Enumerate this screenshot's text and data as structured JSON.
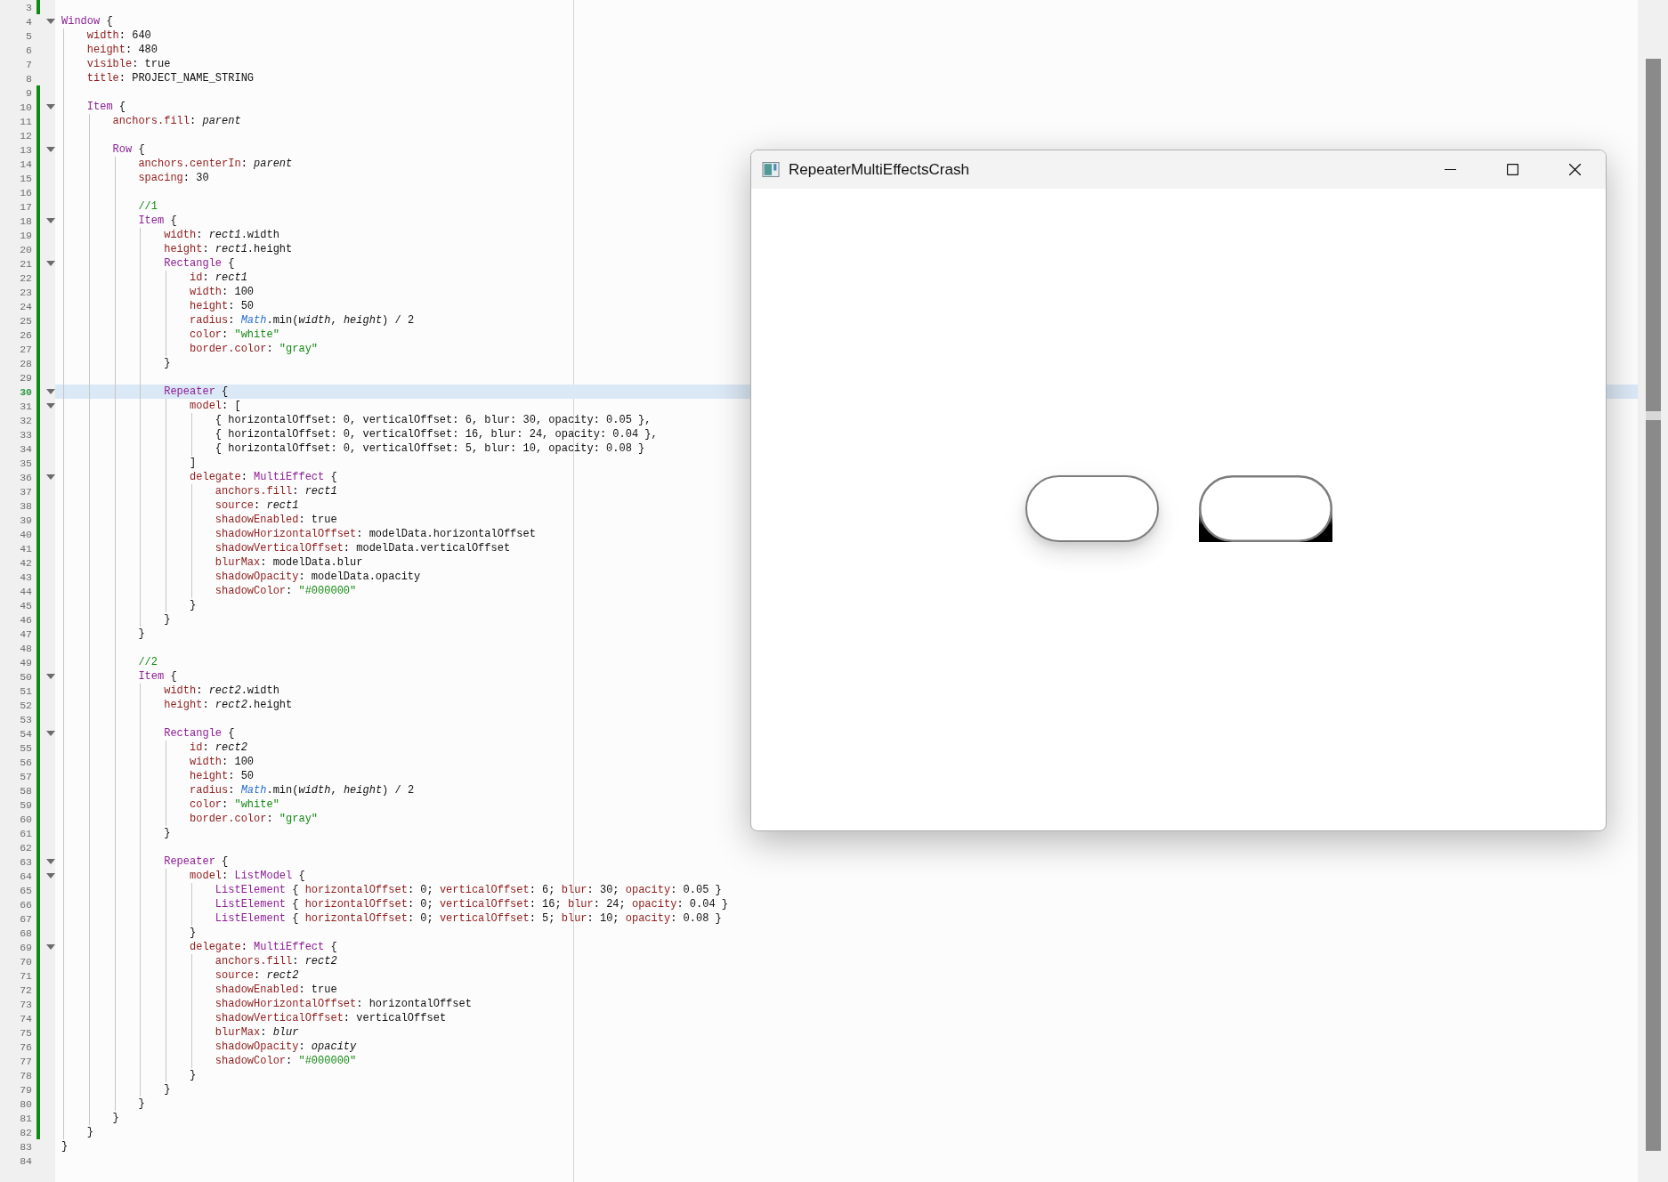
{
  "editor": {
    "lines": [
      {
        "number": "3",
        "fold": false,
        "modified": true,
        "current": false
      },
      {
        "number": "4",
        "fold": true,
        "modified": false,
        "current": false,
        "segs": [
          {
            "kind": "type",
            "text": "Window"
          },
          {
            "kind": "plain",
            "text": " {"
          }
        ]
      },
      {
        "number": "5",
        "fold": false,
        "modified": false,
        "current": false,
        "segs": [
          {
            "kind": "prop",
            "text": "    width"
          },
          {
            "kind": "plain",
            "text": ": 640"
          }
        ]
      },
      {
        "number": "6",
        "fold": false,
        "modified": false,
        "current": false,
        "segs": [
          {
            "kind": "prop",
            "text": "    height"
          },
          {
            "kind": "plain",
            "text": ": 480"
          }
        ]
      },
      {
        "number": "7",
        "fold": false,
        "modified": false,
        "current": false,
        "segs": [
          {
            "kind": "prop",
            "text": "    visible"
          },
          {
            "kind": "plain",
            "text": ": true"
          }
        ]
      },
      {
        "number": "8",
        "fold": false,
        "modified": false,
        "current": false,
        "segs": [
          {
            "kind": "prop",
            "text": "    title"
          },
          {
            "kind": "plain",
            "text": ": PROJECT_NAME_STRING"
          }
        ]
      },
      {
        "number": "9",
        "fold": false,
        "modified": true,
        "current": false
      },
      {
        "number": "10",
        "fold": true,
        "modified": true,
        "current": false,
        "segs": [
          {
            "kind": "type",
            "text": "    Item"
          },
          {
            "kind": "plain",
            "text": " {"
          }
        ]
      },
      {
        "number": "11",
        "fold": false,
        "modified": true,
        "current": false,
        "segs": [
          {
            "kind": "prop",
            "text": "        anchors.fill"
          },
          {
            "kind": "plain",
            "text": ": "
          },
          {
            "kind": "italic",
            "text": "parent"
          }
        ]
      },
      {
        "number": "12",
        "fold": false,
        "modified": true,
        "current": false
      },
      {
        "number": "13",
        "fold": true,
        "modified": true,
        "current": false,
        "segs": [
          {
            "kind": "type",
            "text": "        Row"
          },
          {
            "kind": "plain",
            "text": " {"
          }
        ]
      },
      {
        "number": "14",
        "fold": false,
        "modified": true,
        "current": false,
        "segs": [
          {
            "kind": "prop",
            "text": "            anchors.centerIn"
          },
          {
            "kind": "plain",
            "text": ": "
          },
          {
            "kind": "italic",
            "text": "parent"
          }
        ]
      },
      {
        "number": "15",
        "fold": false,
        "modified": true,
        "current": false,
        "segs": [
          {
            "kind": "prop",
            "text": "            spacing"
          },
          {
            "kind": "plain",
            "text": ": 30"
          }
        ]
      },
      {
        "number": "16",
        "fold": false,
        "modified": true,
        "current": false
      },
      {
        "number": "17",
        "fold": false,
        "modified": true,
        "current": false,
        "segs": [
          {
            "kind": "comment",
            "text": "            //1"
          }
        ]
      },
      {
        "number": "18",
        "fold": true,
        "modified": true,
        "current": false,
        "segs": [
          {
            "kind": "type",
            "text": "            Item"
          },
          {
            "kind": "plain",
            "text": " {"
          }
        ]
      },
      {
        "number": "19",
        "fold": false,
        "modified": true,
        "current": false,
        "segs": [
          {
            "kind": "prop",
            "text": "                width"
          },
          {
            "kind": "plain",
            "text": ": "
          },
          {
            "kind": "italic",
            "text": "rect1"
          },
          {
            "kind": "plain",
            "text": ".width"
          }
        ]
      },
      {
        "number": "20",
        "fold": false,
        "modified": true,
        "current": false,
        "segs": [
          {
            "kind": "prop",
            "text": "                height"
          },
          {
            "kind": "plain",
            "text": ": "
          },
          {
            "kind": "italic",
            "text": "rect1"
          },
          {
            "kind": "plain",
            "text": ".height"
          }
        ]
      },
      {
        "number": "21",
        "fold": true,
        "modified": true,
        "current": false,
        "segs": [
          {
            "kind": "type",
            "text": "                Rectangle"
          },
          {
            "kind": "plain",
            "text": " {"
          }
        ]
      },
      {
        "number": "22",
        "fold": false,
        "modified": true,
        "current": false,
        "segs": [
          {
            "kind": "prop",
            "text": "                    id"
          },
          {
            "kind": "plain",
            "text": ": "
          },
          {
            "kind": "italic",
            "text": "rect1"
          }
        ]
      },
      {
        "number": "23",
        "fold": false,
        "modified": true,
        "current": false,
        "segs": [
          {
            "kind": "prop",
            "text": "                    width"
          },
          {
            "kind": "plain",
            "text": ": 100"
          }
        ]
      },
      {
        "number": "24",
        "fold": false,
        "modified": true,
        "current": false,
        "segs": [
          {
            "kind": "prop",
            "text": "                    height"
          },
          {
            "kind": "plain",
            "text": ": 50"
          }
        ]
      },
      {
        "number": "25",
        "fold": false,
        "modified": true,
        "current": false,
        "segs": [
          {
            "kind": "prop",
            "text": "                    radius"
          },
          {
            "kind": "plain",
            "text": ": "
          },
          {
            "kind": "builtin",
            "text": "Math"
          },
          {
            "kind": "plain",
            "text": ".min("
          },
          {
            "kind": "italic",
            "text": "width"
          },
          {
            "kind": "plain",
            "text": ", "
          },
          {
            "kind": "italic",
            "text": "height"
          },
          {
            "kind": "plain",
            "text": ") / 2"
          }
        ]
      },
      {
        "number": "26",
        "fold": false,
        "modified": true,
        "current": false,
        "segs": [
          {
            "kind": "prop",
            "text": "                    color"
          },
          {
            "kind": "plain",
            "text": ": "
          },
          {
            "kind": "string",
            "text": "\"white\""
          }
        ]
      },
      {
        "number": "27",
        "fold": false,
        "modified": true,
        "current": false,
        "segs": [
          {
            "kind": "prop",
            "text": "                    border.color"
          },
          {
            "kind": "plain",
            "text": ": "
          },
          {
            "kind": "string",
            "text": "\"gray\""
          }
        ]
      },
      {
        "number": "28",
        "fold": false,
        "modified": true,
        "current": false,
        "segs": [
          {
            "kind": "plain",
            "text": "                }"
          }
        ]
      },
      {
        "number": "29",
        "fold": false,
        "modified": true,
        "current": false
      },
      {
        "number": "30",
        "fold": true,
        "modified": true,
        "current": true,
        "segs": [
          {
            "kind": "type",
            "text": "                Repeater"
          },
          {
            "kind": "plain",
            "text": " {"
          }
        ]
      },
      {
        "number": "31",
        "fold": true,
        "modified": true,
        "current": false,
        "segs": [
          {
            "kind": "prop",
            "text": "                    model"
          },
          {
            "kind": "plain",
            "text": ": ["
          }
        ]
      },
      {
        "number": "32",
        "fold": false,
        "modified": true,
        "current": false,
        "segs": [
          {
            "kind": "plain",
            "text": "                        { horizontalOffset: 0, verticalOffset: 6, blur: 30, opacity: 0.05 },"
          }
        ]
      },
      {
        "number": "33",
        "fold": false,
        "modified": true,
        "current": false,
        "segs": [
          {
            "kind": "plain",
            "text": "                        { horizontalOffset: 0, verticalOffset: 16, blur: 24, opacity: 0.04 },"
          }
        ]
      },
      {
        "number": "34",
        "fold": false,
        "modified": true,
        "current": false,
        "segs": [
          {
            "kind": "plain",
            "text": "                        { horizontalOffset: 0, verticalOffset: 5, blur: 10, opacity: 0.08 }"
          }
        ]
      },
      {
        "number": "35",
        "fold": false,
        "modified": true,
        "current": false,
        "segs": [
          {
            "kind": "plain",
            "text": "                    ]"
          }
        ]
      },
      {
        "number": "36",
        "fold": true,
        "modified": true,
        "current": false,
        "segs": [
          {
            "kind": "prop",
            "text": "                    delegate"
          },
          {
            "kind": "plain",
            "text": ": "
          },
          {
            "kind": "type",
            "text": "MultiEffect"
          },
          {
            "kind": "plain",
            "text": " {"
          }
        ]
      },
      {
        "number": "37",
        "fold": false,
        "modified": true,
        "current": false,
        "segs": [
          {
            "kind": "prop",
            "text": "                        anchors.fill"
          },
          {
            "kind": "plain",
            "text": ": "
          },
          {
            "kind": "italic",
            "text": "rect1"
          }
        ]
      },
      {
        "number": "38",
        "fold": false,
        "modified": true,
        "current": false,
        "segs": [
          {
            "kind": "prop",
            "text": "                        source"
          },
          {
            "kind": "plain",
            "text": ": "
          },
          {
            "kind": "italic",
            "text": "rect1"
          }
        ]
      },
      {
        "number": "39",
        "fold": false,
        "modified": true,
        "current": false,
        "segs": [
          {
            "kind": "prop",
            "text": "                        shadowEnabled"
          },
          {
            "kind": "plain",
            "text": ": true"
          }
        ]
      },
      {
        "number": "40",
        "fold": false,
        "modified": true,
        "current": false,
        "segs": [
          {
            "kind": "prop",
            "text": "                        shadowHorizontalOffset"
          },
          {
            "kind": "plain",
            "text": ": modelData.horizontalOffset"
          }
        ]
      },
      {
        "number": "41",
        "fold": false,
        "modified": true,
        "current": false,
        "segs": [
          {
            "kind": "prop",
            "text": "                        shadowVerticalOffset"
          },
          {
            "kind": "plain",
            "text": ": modelData.verticalOffset"
          }
        ]
      },
      {
        "number": "42",
        "fold": false,
        "modified": true,
        "current": false,
        "segs": [
          {
            "kind": "prop",
            "text": "                        blurMax"
          },
          {
            "kind": "plain",
            "text": ": modelData.blur"
          }
        ]
      },
      {
        "number": "43",
        "fold": false,
        "modified": true,
        "current": false,
        "segs": [
          {
            "kind": "prop",
            "text": "                        shadowOpacity"
          },
          {
            "kind": "plain",
            "text": ": modelData.opacity"
          }
        ]
      },
      {
        "number": "44",
        "fold": false,
        "modified": true,
        "current": false,
        "segs": [
          {
            "kind": "prop",
            "text": "                        shadowColor"
          },
          {
            "kind": "plain",
            "text": ": "
          },
          {
            "kind": "string",
            "text": "\"#000000\""
          }
        ]
      },
      {
        "number": "45",
        "fold": false,
        "modified": true,
        "current": false,
        "segs": [
          {
            "kind": "plain",
            "text": "                    }"
          }
        ]
      },
      {
        "number": "46",
        "fold": false,
        "modified": true,
        "current": false,
        "segs": [
          {
            "kind": "plain",
            "text": "                }"
          }
        ]
      },
      {
        "number": "47",
        "fold": false,
        "modified": true,
        "current": false,
        "segs": [
          {
            "kind": "plain",
            "text": "            }"
          }
        ]
      },
      {
        "number": "48",
        "fold": false,
        "modified": true,
        "current": false
      },
      {
        "number": "49",
        "fold": false,
        "modified": true,
        "current": false,
        "segs": [
          {
            "kind": "comment",
            "text": "            //2"
          }
        ]
      },
      {
        "number": "50",
        "fold": true,
        "modified": true,
        "current": false,
        "segs": [
          {
            "kind": "type",
            "text": "            Item"
          },
          {
            "kind": "plain",
            "text": " {"
          }
        ]
      },
      {
        "number": "51",
        "fold": false,
        "modified": true,
        "current": false,
        "segs": [
          {
            "kind": "prop",
            "text": "                width"
          },
          {
            "kind": "plain",
            "text": ": "
          },
          {
            "kind": "italic",
            "text": "rect2"
          },
          {
            "kind": "plain",
            "text": ".width"
          }
        ]
      },
      {
        "number": "52",
        "fold": false,
        "modified": true,
        "current": false,
        "segs": [
          {
            "kind": "prop",
            "text": "                height"
          },
          {
            "kind": "plain",
            "text": ": "
          },
          {
            "kind": "italic",
            "text": "rect2"
          },
          {
            "kind": "plain",
            "text": ".height"
          }
        ]
      },
      {
        "number": "53",
        "fold": false,
        "modified": true,
        "current": false
      },
      {
        "number": "54",
        "fold": true,
        "modified": true,
        "current": false,
        "segs": [
          {
            "kind": "type",
            "text": "                Rectangle"
          },
          {
            "kind": "plain",
            "text": " {"
          }
        ]
      },
      {
        "number": "55",
        "fold": false,
        "modified": true,
        "current": false,
        "segs": [
          {
            "kind": "prop",
            "text": "                    id"
          },
          {
            "kind": "plain",
            "text": ": "
          },
          {
            "kind": "italic",
            "text": "rect2"
          }
        ]
      },
      {
        "number": "56",
        "fold": false,
        "modified": true,
        "current": false,
        "segs": [
          {
            "kind": "prop",
            "text": "                    width"
          },
          {
            "kind": "plain",
            "text": ": 100"
          }
        ]
      },
      {
        "number": "57",
        "fold": false,
        "modified": true,
        "current": false,
        "segs": [
          {
            "kind": "prop",
            "text": "                    height"
          },
          {
            "kind": "plain",
            "text": ": 50"
          }
        ]
      },
      {
        "number": "58",
        "fold": false,
        "modified": true,
        "current": false,
        "segs": [
          {
            "kind": "prop",
            "text": "                    radius"
          },
          {
            "kind": "plain",
            "text": ": "
          },
          {
            "kind": "builtin",
            "text": "Math"
          },
          {
            "kind": "plain",
            "text": ".min("
          },
          {
            "kind": "italic",
            "text": "width"
          },
          {
            "kind": "plain",
            "text": ", "
          },
          {
            "kind": "italic",
            "text": "height"
          },
          {
            "kind": "plain",
            "text": ") / 2"
          }
        ]
      },
      {
        "number": "59",
        "fold": false,
        "modified": true,
        "current": false,
        "segs": [
          {
            "kind": "prop",
            "text": "                    color"
          },
          {
            "kind": "plain",
            "text": ": "
          },
          {
            "kind": "string",
            "text": "\"white\""
          }
        ]
      },
      {
        "number": "60",
        "fold": false,
        "modified": true,
        "current": false,
        "segs": [
          {
            "kind": "prop",
            "text": "                    border.color"
          },
          {
            "kind": "plain",
            "text": ": "
          },
          {
            "kind": "string",
            "text": "\"gray\""
          }
        ]
      },
      {
        "number": "61",
        "fold": false,
        "modified": true,
        "current": false,
        "segs": [
          {
            "kind": "plain",
            "text": "                }"
          }
        ]
      },
      {
        "number": "62",
        "fold": false,
        "modified": true,
        "current": false
      },
      {
        "number": "63",
        "fold": true,
        "modified": true,
        "current": false,
        "segs": [
          {
            "kind": "type",
            "text": "                Repeater"
          },
          {
            "kind": "plain",
            "text": " {"
          }
        ]
      },
      {
        "number": "64",
        "fold": true,
        "modified": true,
        "current": false,
        "segs": [
          {
            "kind": "prop",
            "text": "                    model"
          },
          {
            "kind": "plain",
            "text": ": "
          },
          {
            "kind": "type",
            "text": "ListModel"
          },
          {
            "kind": "plain",
            "text": " {"
          }
        ]
      },
      {
        "number": "65",
        "fold": false,
        "modified": true,
        "current": false,
        "segs": [
          {
            "kind": "type",
            "text": "                        ListElement"
          },
          {
            "kind": "plain",
            "text": " { "
          },
          {
            "kind": "prop",
            "text": "horizontalOffset"
          },
          {
            "kind": "plain",
            "text": ": 0; "
          },
          {
            "kind": "prop",
            "text": "verticalOffset"
          },
          {
            "kind": "plain",
            "text": ": 6; "
          },
          {
            "kind": "prop",
            "text": "blur"
          },
          {
            "kind": "plain",
            "text": ": 30; "
          },
          {
            "kind": "prop",
            "text": "opacity"
          },
          {
            "kind": "plain",
            "text": ": 0.05 }"
          }
        ]
      },
      {
        "number": "66",
        "fold": false,
        "modified": true,
        "current": false,
        "segs": [
          {
            "kind": "type",
            "text": "                        ListElement"
          },
          {
            "kind": "plain",
            "text": " { "
          },
          {
            "kind": "prop",
            "text": "horizontalOffset"
          },
          {
            "kind": "plain",
            "text": ": 0; "
          },
          {
            "kind": "prop",
            "text": "verticalOffset"
          },
          {
            "kind": "plain",
            "text": ": 16; "
          },
          {
            "kind": "prop",
            "text": "blur"
          },
          {
            "kind": "plain",
            "text": ": 24; "
          },
          {
            "kind": "prop",
            "text": "opacity"
          },
          {
            "kind": "plain",
            "text": ": 0.04 }"
          }
        ]
      },
      {
        "number": "67",
        "fold": false,
        "modified": true,
        "current": false,
        "segs": [
          {
            "kind": "type",
            "text": "                        ListElement"
          },
          {
            "kind": "plain",
            "text": " { "
          },
          {
            "kind": "prop",
            "text": "horizontalOffset"
          },
          {
            "kind": "plain",
            "text": ": 0; "
          },
          {
            "kind": "prop",
            "text": "verticalOffset"
          },
          {
            "kind": "plain",
            "text": ": 5; "
          },
          {
            "kind": "prop",
            "text": "blur"
          },
          {
            "kind": "plain",
            "text": ": 10; "
          },
          {
            "kind": "prop",
            "text": "opacity"
          },
          {
            "kind": "plain",
            "text": ": 0.08 }"
          }
        ]
      },
      {
        "number": "68",
        "fold": false,
        "modified": true,
        "current": false,
        "segs": [
          {
            "kind": "plain",
            "text": "                    }"
          }
        ]
      },
      {
        "number": "69",
        "fold": true,
        "modified": true,
        "current": false,
        "segs": [
          {
            "kind": "prop",
            "text": "                    delegate"
          },
          {
            "kind": "plain",
            "text": ": "
          },
          {
            "kind": "type",
            "text": "MultiEffect"
          },
          {
            "kind": "plain",
            "text": " {"
          }
        ]
      },
      {
        "number": "70",
        "fold": false,
        "modified": true,
        "current": false,
        "segs": [
          {
            "kind": "prop",
            "text": "                        anchors.fill"
          },
          {
            "kind": "plain",
            "text": ": "
          },
          {
            "kind": "italic",
            "text": "rect2"
          }
        ]
      },
      {
        "number": "71",
        "fold": false,
        "modified": true,
        "current": false,
        "segs": [
          {
            "kind": "prop",
            "text": "                        source"
          },
          {
            "kind": "plain",
            "text": ": "
          },
          {
            "kind": "italic",
            "text": "rect2"
          }
        ]
      },
      {
        "number": "72",
        "fold": false,
        "modified": true,
        "current": false,
        "segs": [
          {
            "kind": "prop",
            "text": "                        shadowEnabled"
          },
          {
            "kind": "plain",
            "text": ": true"
          }
        ]
      },
      {
        "number": "73",
        "fold": false,
        "modified": true,
        "current": false,
        "segs": [
          {
            "kind": "prop",
            "text": "                        shadowHorizontalOffset"
          },
          {
            "kind": "plain",
            "text": ": horizontalOffset"
          }
        ]
      },
      {
        "number": "74",
        "fold": false,
        "modified": true,
        "current": false,
        "segs": [
          {
            "kind": "prop",
            "text": "                        shadowVerticalOffset"
          },
          {
            "kind": "plain",
            "text": ": verticalOffset"
          }
        ]
      },
      {
        "number": "75",
        "fold": false,
        "modified": true,
        "current": false,
        "segs": [
          {
            "kind": "prop",
            "text": "                        blurMax"
          },
          {
            "kind": "plain",
            "text": ": "
          },
          {
            "kind": "italic",
            "text": "blur"
          }
        ]
      },
      {
        "number": "76",
        "fold": false,
        "modified": true,
        "current": false,
        "segs": [
          {
            "kind": "prop",
            "text": "                        shadowOpacity"
          },
          {
            "kind": "plain",
            "text": ": "
          },
          {
            "kind": "italic",
            "text": "opacity"
          }
        ]
      },
      {
        "number": "77",
        "fold": false,
        "modified": true,
        "current": false,
        "segs": [
          {
            "kind": "prop",
            "text": "                        shadowColor"
          },
          {
            "kind": "plain",
            "text": ": "
          },
          {
            "kind": "string",
            "text": "\"#000000\""
          }
        ]
      },
      {
        "number": "78",
        "fold": false,
        "modified": true,
        "current": false,
        "segs": [
          {
            "kind": "plain",
            "text": "                    }"
          }
        ]
      },
      {
        "number": "79",
        "fold": false,
        "modified": true,
        "current": false,
        "segs": [
          {
            "kind": "plain",
            "text": "                }"
          }
        ]
      },
      {
        "number": "80",
        "fold": false,
        "modified": true,
        "current": false,
        "segs": [
          {
            "kind": "plain",
            "text": "            }"
          }
        ]
      },
      {
        "number": "81",
        "fold": false,
        "modified": true,
        "current": false,
        "segs": [
          {
            "kind": "plain",
            "text": "        }"
          }
        ]
      },
      {
        "number": "82",
        "fold": false,
        "modified": true,
        "current": false,
        "segs": [
          {
            "kind": "plain",
            "text": "    }"
          }
        ]
      },
      {
        "number": "83",
        "fold": false,
        "modified": false,
        "current": false,
        "segs": [
          {
            "kind": "plain",
            "text": "}"
          }
        ]
      },
      {
        "number": "84",
        "fold": false,
        "modified": false,
        "current": false
      }
    ]
  },
  "app_window": {
    "title": "RepeaterMultiEffectsCrash",
    "shapes": [
      {
        "kind": "shadowed"
      },
      {
        "kind": "artifact"
      }
    ]
  }
}
